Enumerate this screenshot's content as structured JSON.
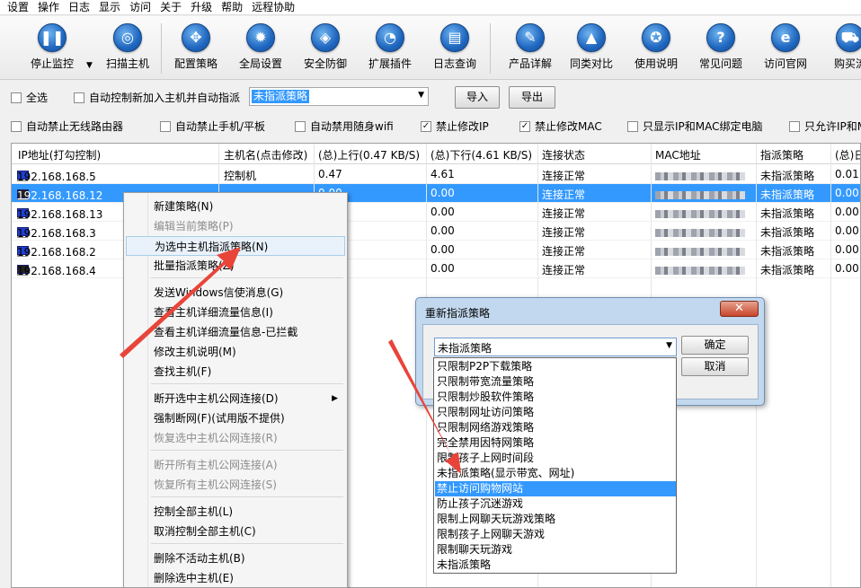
{
  "menubar": [
    "设置",
    "操作",
    "日志",
    "显示",
    "访问",
    "关于",
    "升级",
    "帮助",
    "远程协助"
  ],
  "toolbar": [
    {
      "label": "停止监控",
      "icon": "pause-icon",
      "glyph": "❚❚"
    },
    {
      "label": "扫描主机",
      "icon": "search-icon",
      "glyph": "◎"
    },
    {
      "label": "配置策略",
      "icon": "settings-icon",
      "glyph": "✥"
    },
    {
      "label": "全局设置",
      "icon": "gear-icon",
      "glyph": "✹"
    },
    {
      "label": "安全防御",
      "icon": "shield-icon",
      "glyph": "◈"
    },
    {
      "label": "扩展插件",
      "icon": "plugin-icon",
      "glyph": "◔"
    },
    {
      "label": "日志查询",
      "icon": "log-icon",
      "glyph": "▤"
    },
    {
      "label": "产品详解",
      "icon": "edit-icon",
      "glyph": "✎"
    },
    {
      "label": "同类对比",
      "icon": "graduation-cap-icon",
      "glyph": "▲"
    },
    {
      "label": "使用说明",
      "icon": "award-icon",
      "glyph": "✪"
    },
    {
      "label": "常见问题",
      "icon": "question-icon",
      "glyph": "?"
    },
    {
      "label": "访问官网",
      "icon": "ie-icon",
      "glyph": "e"
    },
    {
      "label": "购买流",
      "icon": "cart-icon",
      "glyph": "⛟"
    }
  ],
  "row1": {
    "select_all": "全选",
    "auto_assign": "自动控制新加入主机并自动指派",
    "policy_value": "未指派策略",
    "import": "导入",
    "export": "导出"
  },
  "row2": [
    {
      "label": "自动禁止无线路由器",
      "checked": false
    },
    {
      "label": "自动禁止手机/平板",
      "checked": false
    },
    {
      "label": "自动禁用随身wifi",
      "checked": false
    },
    {
      "label": "禁止修改IP",
      "checked": true
    },
    {
      "label": "禁止修改MAC",
      "checked": true
    },
    {
      "label": "只显示IP和MAC绑定电脑",
      "checked": false
    },
    {
      "label": "只允许IP和M",
      "checked": false
    }
  ],
  "grid": {
    "headers": [
      "IP地址(打勾控制)",
      "主机名(点击修改)",
      "(总)上行(0.47 KB/S)",
      "(总)下行(4.61 KB/S)",
      "连接状态",
      "MAC地址",
      "指派策略",
      "(总)日"
    ],
    "rows": [
      {
        "ip": "192.168.168.5",
        "host": "控制机",
        "up": "0.47",
        "down": "4.61",
        "status": "连接正常",
        "policy": "未指派策略",
        "extra": "0.01"
      },
      {
        "ip": "192.168.168.12",
        "host": "",
        "up": "0.00",
        "down": "0.00",
        "status": "连接正常",
        "policy": "未指派策略",
        "extra": "0.00"
      },
      {
        "ip": "192.168.168.13",
        "host": "",
        "up": "",
        "down": "0.00",
        "status": "连接正常",
        "policy": "未指派策略",
        "extra": "0.00"
      },
      {
        "ip": "192.168.168.3",
        "host": "",
        "up": "",
        "down": "0.00",
        "status": "连接正常",
        "policy": "未指派策略",
        "extra": "0.00"
      },
      {
        "ip": "192.168.168.2",
        "host": "",
        "up": "",
        "down": "0.00",
        "status": "连接正常",
        "policy": "未指派策略",
        "extra": "0.00"
      },
      {
        "ip": "192.168.168.4",
        "host": "",
        "up": "",
        "down": "0.00",
        "status": "连接正常",
        "policy": "未指派策略",
        "extra": "0.00"
      }
    ]
  },
  "context_menu": [
    {
      "label": "新建策略(N)",
      "state": "normal"
    },
    {
      "label": "编辑当前策略(P)",
      "state": "disabled"
    },
    {
      "label": "为选中主机指派策略(N)",
      "state": "highlighted"
    },
    {
      "label": "批量指派策略(Z)",
      "state": "normal"
    },
    {
      "label": "发送Windows信使消息(G)",
      "state": "normal"
    },
    {
      "label": "查看主机详细流量信息(I)",
      "state": "normal"
    },
    {
      "label": "查看主机详细流量信息-已拦截",
      "state": "normal"
    },
    {
      "label": "修改主机说明(M)",
      "state": "normal"
    },
    {
      "label": "查找主机(F)",
      "state": "normal"
    },
    {
      "label": "断开选中主机公网连接(D)",
      "state": "normal"
    },
    {
      "label": "强制断网(F)(试用版不提供)",
      "state": "normal"
    },
    {
      "label": "恢复选中主机公网连接(R)",
      "state": "disabled"
    },
    {
      "label": "断开所有主机公网连接(A)",
      "state": "disabled"
    },
    {
      "label": "恢复所有主机公网连接(S)",
      "state": "disabled"
    },
    {
      "label": "控制全部主机(L)",
      "state": "normal"
    },
    {
      "label": "取消控制全部主机(C)",
      "state": "normal"
    },
    {
      "label": "删除不活动主机(B)",
      "state": "normal"
    },
    {
      "label": "删除选中主机(E)",
      "state": "normal"
    }
  ],
  "dialog": {
    "title": "重新指派策略",
    "close": "✕",
    "value": "未指派策略",
    "ok": "确定",
    "cancel": "取消",
    "options": [
      "只限制P2P下载策略",
      "只限制带宽流量策略",
      "只限制炒股软件策略",
      "只限制网址访问策略",
      "只限制网络游戏策略",
      "完全禁用因特网策略",
      "限制孩子上网时间段",
      "未指派策略(显示带宽、网址)",
      "禁止访问购物网站",
      "防止孩子沉迷游戏",
      "限制上网聊天玩游戏策略",
      "限制孩子上网聊天游戏",
      "限制聊天玩游戏",
      "未指派策略"
    ],
    "selected_index": 8
  },
  "colors": {
    "selection": "#3399ff",
    "arrow": "#e8443a",
    "dialog_frame": "#c2d8ee"
  }
}
